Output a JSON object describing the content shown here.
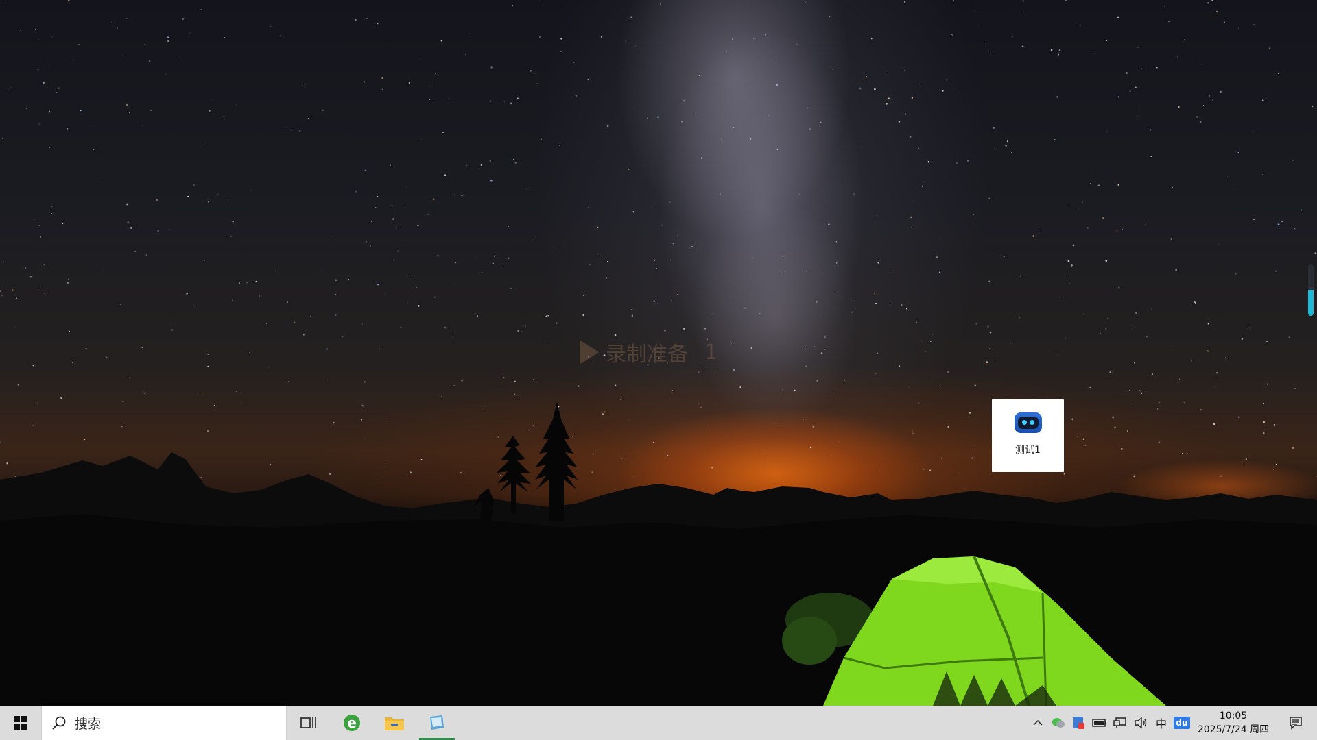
{
  "desktop": {
    "watermark_text": "录制准备",
    "watermark_count": "1",
    "icons": [
      {
        "label": "测试1",
        "icon": "robot-app-icon"
      }
    ]
  },
  "taskbar": {
    "start_icon": "windows-logo-icon",
    "search": {
      "label": "搜索",
      "icon": "search-icon"
    },
    "pinned": [
      {
        "name": "task-view",
        "icon": "task-view-icon"
      },
      {
        "name": "edge-browser",
        "icon": "edge-icon"
      },
      {
        "name": "file-explorer",
        "icon": "folder-icon"
      },
      {
        "name": "running-app",
        "icon": "app-icon",
        "active": true
      }
    ],
    "tray": {
      "overflow_icon": "chevron-up-icon",
      "ime_label": "中",
      "baidu_label": "du"
    },
    "clock": {
      "time": "10:05",
      "date": "2025/7/24 周四"
    },
    "notification_icon": "notification-icon"
  },
  "colors": {
    "taskbar_bg": "#dcdcdc",
    "active_indicator": "#2f8f46",
    "tent_green": "#7fd81e",
    "horizon_glow": "#ff7a10"
  }
}
